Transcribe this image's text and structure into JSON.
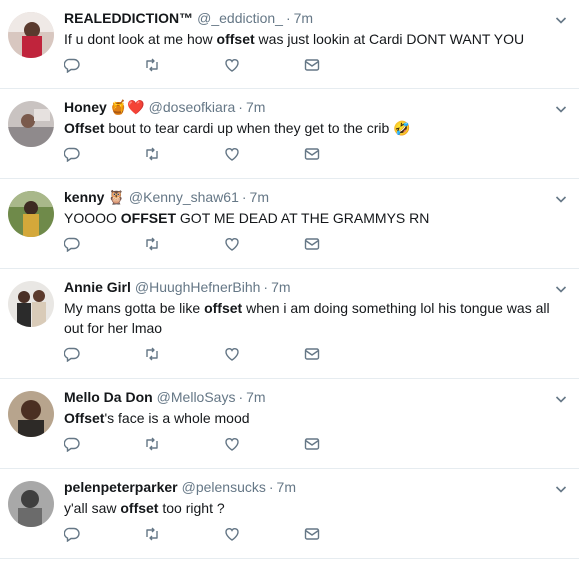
{
  "colors": {
    "name": "#14171a",
    "meta": "#657786",
    "icon": "#657786",
    "divider": "#e6ecf0",
    "heart_red": "#e0245e"
  },
  "icons": {
    "reply": "reply-icon",
    "retweet": "retweet-icon",
    "like": "heart-icon",
    "dm": "envelope-icon",
    "menu": "chevron-down-icon"
  },
  "tweets": [
    {
      "name": "REALEDDICTION™",
      "handle": "@_eddiction_",
      "dot": "·",
      "time": "7m",
      "text_parts": [
        "If u dont look at me how ",
        "offset",
        " was just lookin at Cardi  DONT WANT YOU"
      ]
    },
    {
      "name": "Honey",
      "name_emoji": "🍯❤️",
      "handle": "@doseofkiara",
      "dot": "·",
      "time": "7m",
      "text_parts": [
        "",
        "Offset",
        " bout to tear cardi up when they get to the crib 🤣"
      ]
    },
    {
      "name": "kenny",
      "name_emoji": "🦉",
      "handle": "@Kenny_shaw61",
      "dot": "·",
      "time": "7m",
      "text_parts": [
        "YOOOO ",
        "OFFSET",
        " GOT ME DEAD AT THE GRAMMYS RN"
      ]
    },
    {
      "name": "Annie Girl",
      "handle": "@HuughHefnerBihh",
      "dot": "·",
      "time": "7m",
      "text_parts": [
        "My mans gotta be like ",
        "offset",
        " when i am doing something lol his tongue was all out for her lmao"
      ]
    },
    {
      "name": "Mello Da Don",
      "handle": "@MelloSays",
      "dot": "·",
      "time": "7m",
      "text_parts": [
        "",
        "Offset",
        "'s face is a whole mood"
      ]
    },
    {
      "name": "pelenpeterparker",
      "handle": "@pelensucks",
      "dot": "·",
      "time": "7m",
      "text_parts": [
        "y'all saw ",
        "offset",
        " too right ?"
      ]
    }
  ]
}
